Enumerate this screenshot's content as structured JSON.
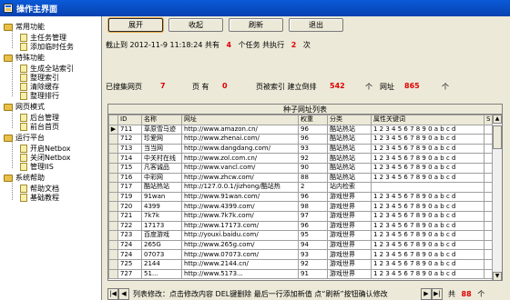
{
  "window": {
    "title": "操作主界面"
  },
  "sidebar": {
    "groups": [
      {
        "label": "常用功能",
        "items": [
          "主任务管理",
          "添加临时任务"
        ]
      },
      {
        "label": "特殊功能",
        "items": [
          "生成全站索引",
          "整理索引",
          "清除缓存",
          "整理排行"
        ]
      },
      {
        "label": "网页模式",
        "items": [
          "后台管理",
          "前台首页"
        ]
      },
      {
        "label": "运行平台",
        "items": [
          "开启Netbox",
          "关闭Netbox",
          "管理IIS"
        ]
      },
      {
        "label": "系统帮助",
        "items": [
          "帮助文档",
          "基础教程"
        ]
      }
    ]
  },
  "toolbar": {
    "expand": "展开",
    "collapse": "收起",
    "refresh": "刷新",
    "exit": "退出"
  },
  "status": {
    "prefix": "截止到",
    "datetime": "2012-11-9 11:18:24",
    "total_label": "共有",
    "task_count": "4",
    "tasks_label": "个任务 共执行",
    "exec_count": "2",
    "exec_unit": "次"
  },
  "stats": {
    "collected_label": "已搜集网页",
    "collected": "7",
    "pages_label": "页 有",
    "pages": "0",
    "indexed_label": "页被索引 建立倒排",
    "inverted": "542",
    "unit": "个",
    "site_label": "网址",
    "sites": "865"
  },
  "grid": {
    "caption": "种子网址列表",
    "columns": [
      "ID",
      "名称",
      "网址",
      "权重",
      "分类",
      "属性关键词",
      "S"
    ],
    "rows": [
      [
        "711",
        "草原雪马迹",
        "http://www.amazon.cn/",
        "96",
        "酷站热站",
        "1 2 3 4 5 6 7 8 9 0 a b c d"
      ],
      [
        "712",
        "珍爱网",
        "http://www.zhenai.com/",
        "96",
        "酷站热站",
        "1 2 3 4 5 6 7 8 9 0 a b c d"
      ],
      [
        "713",
        "当当网",
        "http://www.dangdang.com/",
        "93",
        "酷站热站",
        "1 2 3 4 5 6 7 8 9 0 a b c d"
      ],
      [
        "714",
        "中关村在线",
        "http://www.zol.com.cn/",
        "92",
        "酷站热站",
        "1 2 3 4 5 6 7 8 9 0 a b c d"
      ],
      [
        "715",
        "凡客诚品",
        "http://www.vancl.com/",
        "90",
        "酷站热站",
        "1 2 3 4 5 6 7 8 9 0 a b c d"
      ],
      [
        "716",
        "中彩网",
        "http://www.zhcw.com/",
        "88",
        "酷站热站",
        "1 2 3 4 5 6 7 8 9 0 a b c d"
      ],
      [
        "717",
        "酷站热站",
        "http://127.0.0.1/jizhong/酷站热",
        "2",
        "站内检索",
        ""
      ],
      [
        "719",
        "91wan",
        "http://www.91wan.com/",
        "96",
        "游戏世界",
        "1 2 3 4 5 6 7 8 9 0 a b c d"
      ],
      [
        "720",
        "4399",
        "http://www.4399.com/",
        "98",
        "游戏世界",
        "1 2 3 4 5 6 7 8 9 0 a b c d"
      ],
      [
        "721",
        "7k7k",
        "http://www.7k7k.com/",
        "97",
        "游戏世界",
        "1 2 3 4 5 6 7 8 9 0 a b c d"
      ],
      [
        "722",
        "17173",
        "http://www.17173.com/",
        "96",
        "游戏世界",
        "1 2 3 4 5 6 7 8 9 0 a b c d"
      ],
      [
        "723",
        "百度游戏",
        "http://youxi.baidu.com/",
        "95",
        "游戏世界",
        "1 2 3 4 5 6 7 8 9 0 a b c d"
      ],
      [
        "724",
        "265G",
        "http://www.265g.com/",
        "94",
        "游戏世界",
        "1 2 3 4 5 6 7 8 9 0 a b c d"
      ],
      [
        "724",
        "07073",
        "http://www.07073.com/",
        "93",
        "游戏世界",
        "1 2 3 4 5 6 7 8 9 0 a b c d"
      ],
      [
        "725",
        "2144",
        "http://www.2144.cn/",
        "92",
        "游戏世界",
        "1 2 3 4 5 6 7 8 9 0 a b c d"
      ],
      [
        "727",
        "51...",
        "http://www.5173...",
        "91",
        "游戏世界",
        "1 2 3 4 5 6 7 8 9 0 a b c d"
      ]
    ]
  },
  "navigator": {
    "first": "|◀",
    "prev": "◀",
    "message": "列表修改：点击修改内容 DEL键删除 最后一行添加新值 点“刷新”按钮确认修改",
    "next": "▶",
    "last": "▶|",
    "total_label": "共",
    "total": "88",
    "total_unit": "个"
  },
  "colors": {
    "highlight": "#e00000",
    "titlebar": "#0a5ad8"
  }
}
